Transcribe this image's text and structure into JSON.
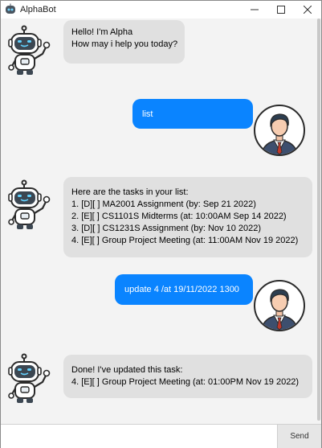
{
  "window": {
    "title": "AlphaBot",
    "icon": "robot-icon"
  },
  "messages": [
    {
      "sender": "bot",
      "avatar": "robot-avatar",
      "text": "Hello! I'm Alpha\nHow may i help you today?"
    },
    {
      "sender": "user",
      "avatar": "user-avatar",
      "text": "list"
    },
    {
      "sender": "bot",
      "avatar": "robot-avatar",
      "text": "Here are the tasks in your list:\n1. [D][ ] MA2001 Assignment (by: Sep 21 2022)\n2. [E][ ] CS1101S Midterms (at: 10:00AM Sep 14 2022)\n3. [D][ ] CS1231S Assignment (by: Nov 10 2022)\n4. [E][ ] Group Project Meeting (at: 11:00AM Nov 19 2022)"
    },
    {
      "sender": "user",
      "avatar": "user-avatar",
      "text": "update 4 /at 19/11/2022 1300"
    },
    {
      "sender": "bot",
      "avatar": "robot-avatar",
      "text": "Done! I've updated this task:\n4. [E][ ] Group Project Meeting (at: 01:00PM Nov 19 2022)"
    }
  ],
  "input": {
    "value": "",
    "placeholder": ""
  },
  "send_label": "Send",
  "colors": {
    "user_bubble": "#0a84ff",
    "bot_bubble": "#e0e0e0",
    "background": "#f3f3f3"
  }
}
